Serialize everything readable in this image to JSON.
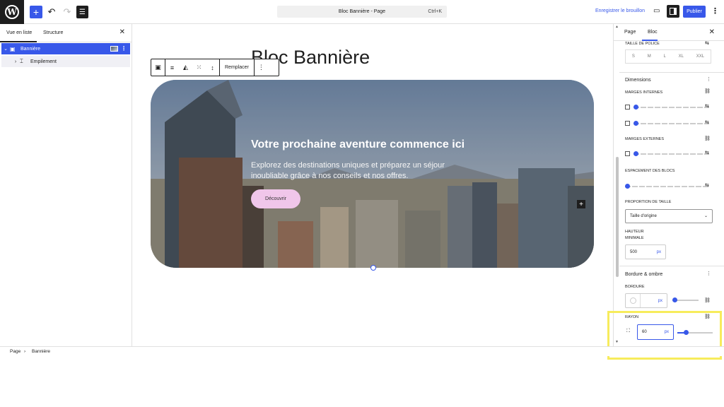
{
  "topbar": {
    "document_title": "Bloc Bannière - Page",
    "shortcut": "Ctrl+K",
    "save_draft": "Enregistrer le brouillon",
    "publish": "Publier"
  },
  "list_view": {
    "tab_list": "Vue en liste",
    "tab_structure": "Structure",
    "items": [
      {
        "label": "Bannière"
      },
      {
        "label": "Empilement"
      }
    ]
  },
  "canvas": {
    "page_title": "Bloc Bannière",
    "toolbar": {
      "replace": "Remplacer"
    },
    "banner": {
      "heading": "Votre prochaine aventure commence ici",
      "text": "Explorez des destinations uniques et préparez un séjour inoubliable grâce à nos conseils et nos offres.",
      "button": "Découvrir"
    }
  },
  "sidebar": {
    "tab_page": "Page",
    "tab_block": "Bloc",
    "font_size_label": "TAILLE DE POLICE",
    "font_sizes": [
      "S",
      "M",
      "L",
      "XL",
      "XXL"
    ],
    "dimensions_heading": "Dimensions",
    "padding_label": "MARGES INTERNES",
    "margin_label": "MARGES EXTERNES",
    "block_spacing_label": "ESPACEMENT DES BLOCS",
    "aspect_ratio_label": "PROPORTION DE TAILLE",
    "aspect_ratio_value": "Taille d'origine",
    "min_height_label_1": "HAUTEUR",
    "min_height_label_2": "MINIMALE",
    "min_height_value": "500",
    "min_height_unit": "px",
    "border_heading": "Bordure & ombre",
    "border_label": "BORDURE",
    "border_unit": "px",
    "radius_label": "RAYON",
    "radius_value": "60",
    "radius_unit": "px"
  },
  "breadcrumb": {
    "root": "Page",
    "current": "Bannière"
  },
  "colors": {
    "accent": "#3858e9",
    "button_pink": "#f0c6ea",
    "highlight": "#f7ec5c"
  }
}
